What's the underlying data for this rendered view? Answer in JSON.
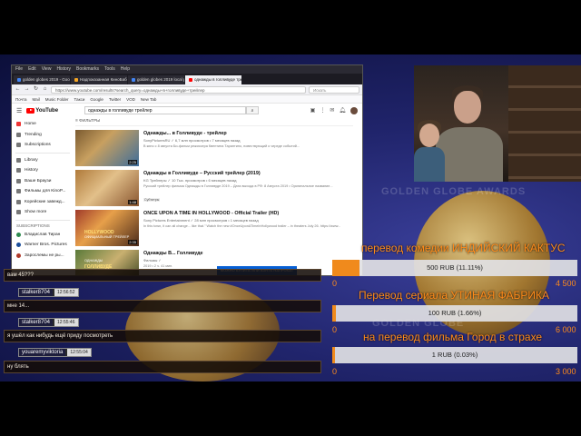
{
  "browser": {
    "menu": [
      "File",
      "Edit",
      "View",
      "History",
      "Bookmarks",
      "Tools",
      "Help"
    ],
    "tabs": [
      {
        "label": "golden globes 2019 - Google",
        "active": false
      },
      {
        "label": "Надпоказанная КиноБабка!",
        "active": false
      },
      {
        "label": "golden globes 2019 local pics",
        "active": false
      },
      {
        "label": "однажды в голливуде трейл",
        "active": true
      }
    ],
    "url": "https://www.youtube.com/results?search_query=однажды+в+голливуде+трейлер",
    "search_placeholder": "Искать",
    "bookmarks": [
      "Почта",
      "Mail",
      "Music Folder",
      "Такси",
      "Google",
      "Twitter",
      "VOD",
      "New Tab"
    ]
  },
  "youtube": {
    "logo_text": "YouTube",
    "search_query": "однажды в голливуде трейлер",
    "sidebar": {
      "main": [
        "Home",
        "Trending",
        "Subscriptions"
      ],
      "library": [
        "Library",
        "History",
        "Ваше Браузи",
        "Фильмы для KinoP...",
        "Корейские завежд...",
        "Show more"
      ],
      "subs_heading": "SUBSCRIPTIONS",
      "subscriptions": [
        "Владислав Тиран",
        "Warner Bros. Pictures",
        "Зарослемы не ры..."
      ]
    },
    "filters_label": "ФИЛЬТРЫ",
    "results": [
      {
        "title": "Однажды... в Голливуде - трейлер",
        "meta": "SonyPicturesRU ✓ 6,7 млн просмотров • 7 месяцев назад",
        "desc": "В кино с 8 августа Би-фильм режиссера Квентина Тарантино, повествующий о череде событий...",
        "duration": "2:25"
      },
      {
        "title": "Однажды в Голливуде – Русский трейлер (2019)",
        "meta": "KG Трейлеры ✓ 10 Тыс. просмотров • 6 месяцев назад",
        "desc": "Русский трейлер фильма Однажды в Голливуде 2019 – Дата выхода в РФ: 8 Августа 2019 • Оригинальное название...",
        "duration": "1:48",
        "badge": "Субтитры"
      },
      {
        "title": "ONCE UPON A TIME IN HOLLYWOOD - Official Trailer (HD)",
        "meta": "Sony Pictures Entertainment ✓ 28 млн просмотров • 1 месяцев назад",
        "desc": "In this town, it can all change... like that.\" Watch the new #OnceUponATimeInHollywood trailer – in theaters July 26. https://www...",
        "duration": "2:35",
        "thumb_title": "HOLLYWOOD",
        "thumb_sub": "ОФИЦИАЛЬНЫЙ ТРЕЙЛЕР"
      },
      {
        "title": "Однажды В... Голливуде",
        "meta": "Фильмы ✓",
        "desc": "2019 • 2 ч. 41 мин.",
        "duration": "",
        "thumb_title": "ГОЛЛИВУДЕ",
        "thumb_sub": "ОДНАЖДЫ"
      }
    ],
    "promo_button": "МОЖНО КУПИТЬ ИЛИ ВЗЯТЬ НАПРОКАТ"
  },
  "chat": [
    {
      "text": "вам 45???"
    },
    {
      "user": "stalker8704",
      "time": "12:56:52"
    },
    {
      "text": "мне 14..."
    },
    {
      "user": "stalker8704",
      "time": "12:55:46"
    },
    {
      "text": "я ушёл как нибудь ещё приду посмотреть"
    },
    {
      "user": "youaremyviktoria",
      "time": "12:55:04"
    },
    {
      "text": "ну блять"
    }
  ],
  "goals": [
    {
      "title": "перевод комедии ИНДИЙСКИЙ КАКТУС",
      "label": "500 RUB (11.11%)",
      "progress": 0.1111,
      "min": "0",
      "max": "4 500"
    },
    {
      "title": "Перевод сериала УТИНАЯ ФАБРИКА",
      "label": "100 RUB (1.66%)",
      "progress": 0.0166,
      "min": "0",
      "max": "6 000"
    },
    {
      "title": "на перевод фильма Город в страхе",
      "label": "1 RUB (0.03%)",
      "progress": 0.0003,
      "min": "0",
      "max": "3 000"
    }
  ],
  "colors": {
    "goal_accent": "#ff8b1a",
    "goal_fill": "#f08a1c",
    "youtube_red": "#ff0000",
    "promo_blue": "#065fd4"
  }
}
